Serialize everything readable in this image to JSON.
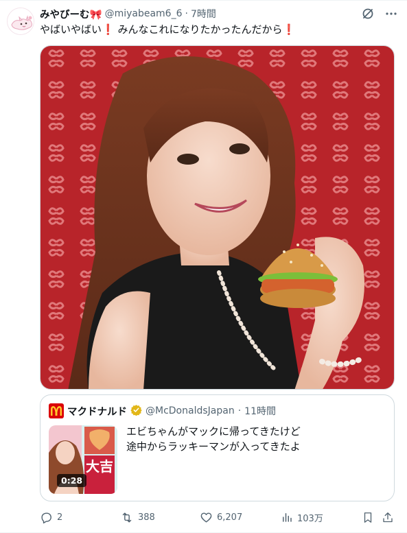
{
  "tweet": {
    "display_name": "みやびーむ🎀",
    "handle": "@miyabeam6_6",
    "separator": "·",
    "time": "7時間",
    "text_main": "やばいやばい",
    "text_mark": "❗",
    "text_rest": " みんなこれになりたかったんだから",
    "image_icon": "photo-woman-holding-burger"
  },
  "quote": {
    "logo_icon": "mcdonalds-logo",
    "name": "マクドナルド",
    "verified_icon": "gold-verified-badge",
    "handle": "@McDonaldsJapan",
    "separator": "·",
    "time": "11時間",
    "text_line1": "エビちゃんがマックに帰ってきたけど",
    "text_line2": "途中からラッキーマンが入ってきたよ",
    "thumbnail_icon": "video-thumbnail",
    "thumbnail_caption": "大吉",
    "video_duration": "0:28"
  },
  "actions": {
    "replies": "2",
    "reposts": "388",
    "likes": "6,207",
    "views": "103万"
  },
  "colors": {
    "text": "#0f1419",
    "secondary": "#536471",
    "border": "#cfd9de",
    "mcd_red": "#db0007",
    "mcd_yellow": "#ffc72c",
    "verified_gold": "#e2b719",
    "alert_red": "#e0245e"
  }
}
